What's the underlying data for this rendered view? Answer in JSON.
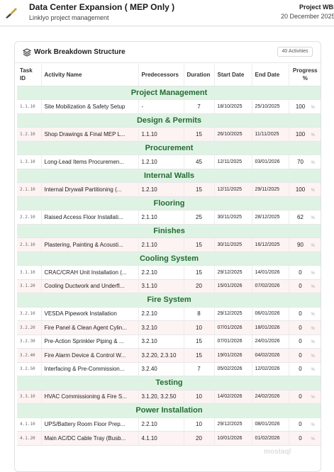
{
  "header": {
    "title": "Data Center Expansion ( MEP Only )",
    "subtitle": "Linklyo project management",
    "right_label": "Project WBS",
    "date": "20 December 2025"
  },
  "wbs": {
    "title": "Work Breakdown Structure",
    "count_badge": "40 Activities",
    "columns": [
      "Task ID",
      "Activity Name",
      "Predecessors",
      "Duration",
      "Start Date",
      "End Date",
      "Progress %"
    ],
    "pct_symbol": "%",
    "rows": [
      {
        "type": "section",
        "name": "Project Management"
      },
      {
        "type": "task",
        "id": "1.1.10",
        "name": "Site Mobilization & Safety Setup",
        "pred": "-",
        "dur": "7",
        "start": "18/10/2025",
        "end": "25/10/2025",
        "progress": "100"
      },
      {
        "type": "section",
        "name": "Design & Permits"
      },
      {
        "type": "task",
        "id": "1.2.10",
        "name": "Shop Drawings & Final MEP L...",
        "pred": "1.1.10",
        "dur": "15",
        "start": "26/10/2025",
        "end": "11/11/2025",
        "progress": "100"
      },
      {
        "type": "section",
        "name": "Procurement"
      },
      {
        "type": "task",
        "id": "1.3.10",
        "name": "Long-Lead Items Procuremen...",
        "pred": "1.2.10",
        "dur": "45",
        "start": "12/11/2025",
        "end": "03/01/2026",
        "progress": "70"
      },
      {
        "type": "section",
        "name": "Internal Walls"
      },
      {
        "type": "task",
        "id": "2.1.10",
        "name": "Internal Drywall Partitioning (...",
        "pred": "1.2.10",
        "dur": "15",
        "start": "12/11/2025",
        "end": "29/11/2025",
        "progress": "100"
      },
      {
        "type": "section",
        "name": "Flooring"
      },
      {
        "type": "task",
        "id": "2.2.10",
        "name": "Raised Access Floor Installati...",
        "pred": "2.1.10",
        "dur": "25",
        "start": "30/11/2025",
        "end": "28/12/2025",
        "progress": "62"
      },
      {
        "type": "section",
        "name": "Finishes"
      },
      {
        "type": "task",
        "id": "2.3.10",
        "name": "Plastering, Painting & Acousti...",
        "pred": "2.1.10",
        "dur": "15",
        "start": "30/11/2025",
        "end": "16/12/2025",
        "progress": "90"
      },
      {
        "type": "section",
        "name": "Cooling System"
      },
      {
        "type": "task",
        "id": "3.1.10",
        "name": "CRAC/CRAH Unit Installation (...",
        "pred": "2.2.10",
        "dur": "15",
        "start": "29/12/2025",
        "end": "14/01/2026",
        "progress": "0"
      },
      {
        "type": "task",
        "id": "3.1.20",
        "name": "Cooling Ductwork and Underfl...",
        "pred": "3.1.10",
        "dur": "20",
        "start": "15/01/2026",
        "end": "07/02/2026",
        "progress": "0"
      },
      {
        "type": "section",
        "name": "Fire System"
      },
      {
        "type": "task",
        "id": "3.2.10",
        "name": "VESDA Pipework Installation",
        "pred": "2.2.10",
        "dur": "8",
        "start": "29/12/2025",
        "end": "06/01/2026",
        "progress": "0"
      },
      {
        "type": "task",
        "id": "3.2.20",
        "name": "Fire Panel & Clean Agent Cylin...",
        "pred": "3.2.10",
        "dur": "10",
        "start": "07/01/2026",
        "end": "18/01/2026",
        "progress": "0"
      },
      {
        "type": "task",
        "id": "3.2.30",
        "name": "Pre-Action Sprinkler Piping & ...",
        "pred": "3.2.10",
        "dur": "15",
        "start": "07/01/2026",
        "end": "24/01/2026",
        "progress": "0"
      },
      {
        "type": "task",
        "id": "3.2.40",
        "name": "Fire Alarm Device & Control W...",
        "pred": "3.2.20, 2.3.10",
        "dur": "15",
        "start": "19/01/2026",
        "end": "04/02/2026",
        "progress": "0"
      },
      {
        "type": "task",
        "id": "3.2.50",
        "name": "Interfacing & Pre-Commission...",
        "pred": "3.2.40",
        "dur": "7",
        "start": "05/02/2026",
        "end": "12/02/2026",
        "progress": "0"
      },
      {
        "type": "section",
        "name": "Testing"
      },
      {
        "type": "task",
        "id": "3.3.10",
        "name": "HVAC Commissioning & Fire S...",
        "pred": "3.1.20, 3.2.50",
        "dur": "10",
        "start": "14/02/2026",
        "end": "24/02/2026",
        "progress": "0"
      },
      {
        "type": "section",
        "name": "Power Installation"
      },
      {
        "type": "task",
        "id": "4.1.10",
        "name": "UPS/Battery Room Floor Prep...",
        "pred": "2.2.10",
        "dur": "10",
        "start": "29/12/2025",
        "end": "08/01/2026",
        "progress": "0"
      },
      {
        "type": "task",
        "id": "4.1.20",
        "name": "Main AC/DC Cable Tray (Busb...",
        "pred": "4.1.10",
        "dur": "20",
        "start": "10/01/2026",
        "end": "01/02/2026",
        "progress": "0"
      }
    ]
  }
}
